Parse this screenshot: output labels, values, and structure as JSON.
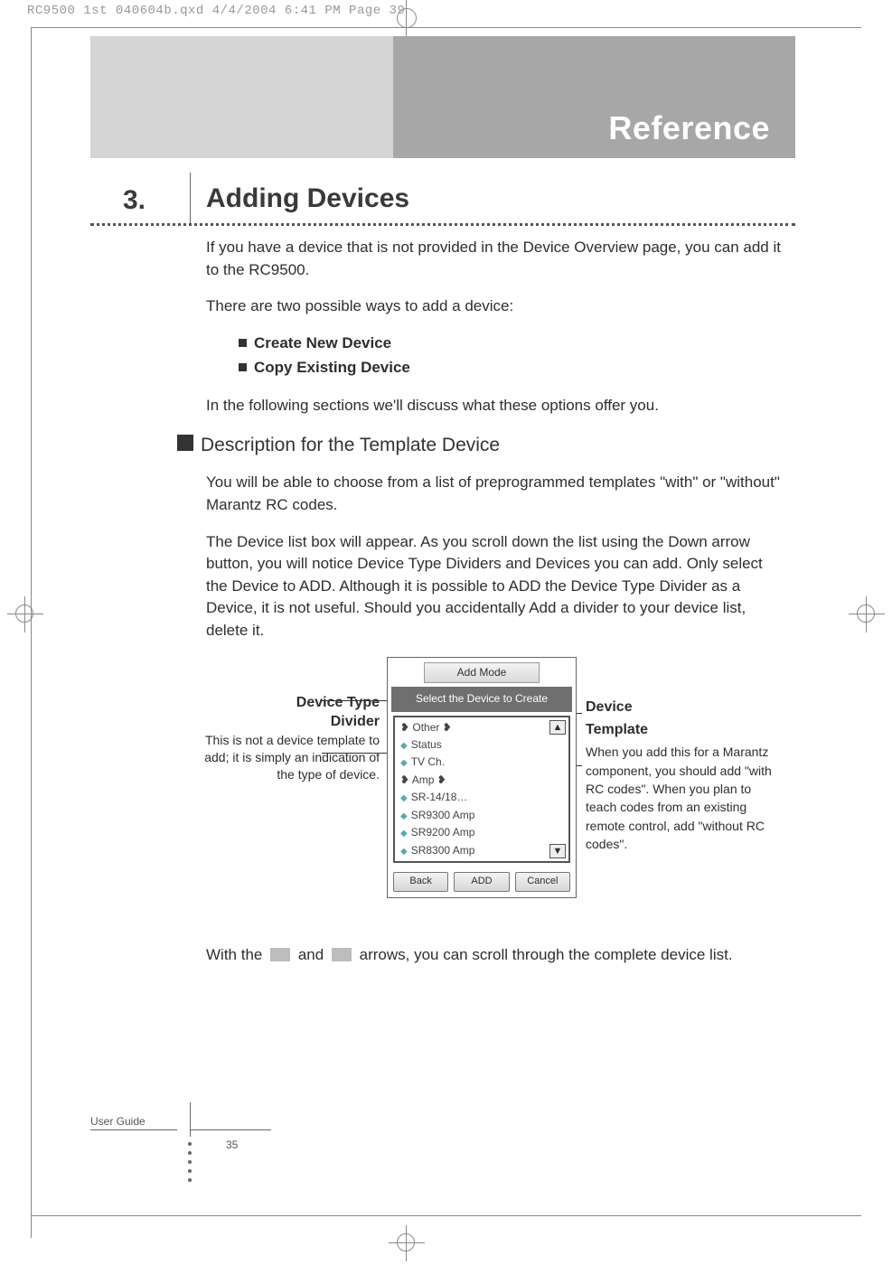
{
  "print_header": "RC9500 1st 040604b.qxd  4/4/2004  6:41 PM  Page 39",
  "banner_title": "Reference",
  "section_number": "3.",
  "section_heading": "Adding Devices",
  "para1": "If you have a device that is not provided in the Device Overview page, you can add it to the RC9500.",
  "para2": "There are two possible ways to add a device:",
  "bullet1": "Create New Device",
  "bullet2": "Copy Existing Device",
  "para3": "In the following sections we'll discuss what these options offer you.",
  "subheading": "Description for the Template Device",
  "para4": "You will be able to choose from a list of preprogrammed templates \"with\" or \"without\" Marantz RC codes.",
  "para5": "The Device list box will appear. As you scroll down the list using the Down arrow button, you will notice Device Type Dividers and Devices you can add. Only select the Device to ADD. Although it is possible to ADD the Device Type Divider as a Device, it is not useful. Should you accidentally Add a divider to your device list, delete it.",
  "callout_left_title1": "Device Type",
  "callout_left_title2": "Divider",
  "callout_left_body": "This is not a device template to add; it is simply an indication of the type of device.",
  "callout_right_title1": "Device",
  "callout_right_title2": "Template",
  "callout_right_body": "When you add this for a Marantz component, you should add \"with RC codes\". When you plan to teach codes from an existing remote control, add \"without RC codes\".",
  "screen": {
    "title": "Add Mode",
    "subtitle": "Select the Device to Create",
    "items": [
      "❥ Other ❥",
      "Status",
      "TV Ch.",
      "❥ Amp ❥",
      "SR-14/18…",
      "SR9300 Amp",
      "SR9200 Amp",
      "SR8300 Amp"
    ],
    "up": "▲",
    "down": "▼",
    "btn_back": "Back",
    "btn_add": "ADD",
    "btn_cancel": "Cancel"
  },
  "para6a": "With the ",
  "para6b": " and ",
  "para6c": " arrows, you can scroll through the complete device list.",
  "footer_label": "User Guide",
  "page_number": "35"
}
